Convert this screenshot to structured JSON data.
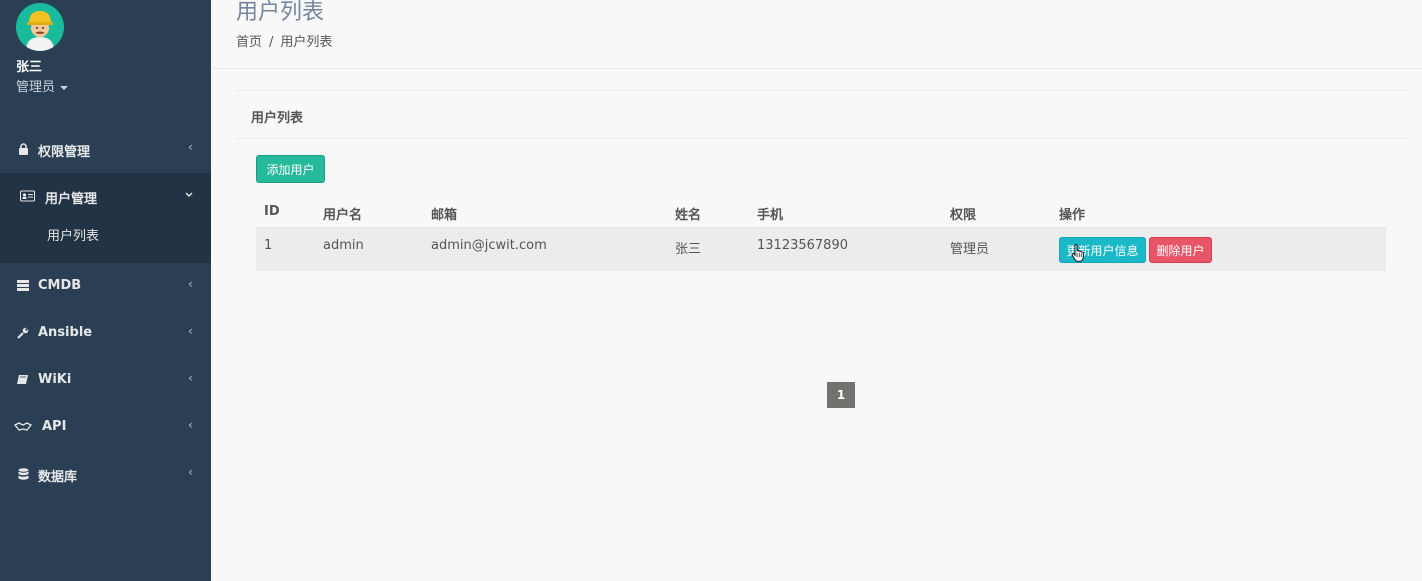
{
  "profile": {
    "name": "张三",
    "role": "管理员"
  },
  "menu": [
    {
      "label": "权限管理",
      "icon": "lock-icon",
      "chevron": "‹"
    },
    {
      "label": "用户管理",
      "icon": "id-card-icon",
      "chevron": "⌄",
      "active": true,
      "children": [
        {
          "label": "用户列表"
        }
      ]
    },
    {
      "label": "CMDB",
      "icon": "server-icon",
      "chevron": "‹"
    },
    {
      "label": "Ansible",
      "icon": "wrench-icon",
      "chevron": "‹"
    },
    {
      "label": "WiKi",
      "icon": "book-icon",
      "chevron": "‹"
    },
    {
      "label": "API",
      "icon": "handshake-icon",
      "chevron": "‹"
    },
    {
      "label": "数据库",
      "icon": "database-icon",
      "chevron": "‹"
    }
  ],
  "header": {
    "title": "用户列表",
    "breadcrumb": {
      "home": "首页",
      "sep": "/",
      "current": "用户列表"
    }
  },
  "panel": {
    "title": "用户列表",
    "add_button": "添加用户"
  },
  "table": {
    "columns": [
      "ID",
      "用户名",
      "邮箱",
      "姓名",
      "手机",
      "权限",
      "操作"
    ],
    "rows": [
      {
        "id": "1",
        "username": "admin",
        "email": "admin@jcwit.com",
        "name": "张三",
        "phone": "13123567890",
        "role": "管理员",
        "update_label": "更新用户信息",
        "delete_label": "删除用户"
      }
    ]
  },
  "pagination": {
    "current": "1"
  },
  "colors": {
    "sidebar": "#2a3f54",
    "accent_green": "#26b99a",
    "accent_cyan": "#1bb8c8",
    "accent_red": "#e85468"
  }
}
